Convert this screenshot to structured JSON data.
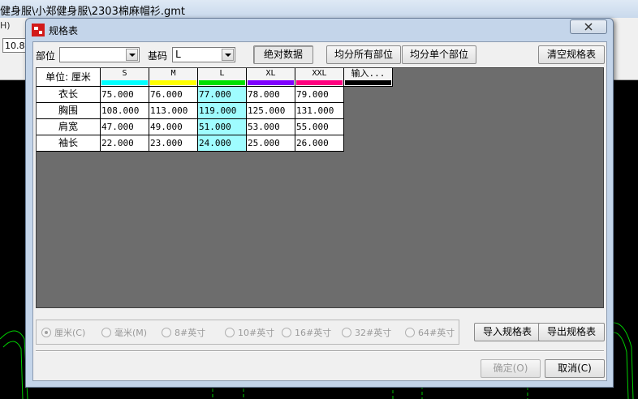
{
  "background_app": {
    "title": "健身服\\小郑健身服\\2303棉麻帽衫.gmt",
    "menu_fragment": "H)",
    "toolbar_value": "10.8"
  },
  "dialog": {
    "title": "规格表",
    "part_label": "部位",
    "part_value": "",
    "base_size_label": "基码",
    "base_size_value": "L",
    "absolute_data_label": "绝对数据",
    "distribute_all_label": "均分所有部位",
    "distribute_single_label": "均分单个部位",
    "clear_table_label": "清空规格表",
    "grid": {
      "unit_header": "单位: 厘米",
      "input_header": "输入...",
      "base_size": "L",
      "sizes": [
        {
          "name": "S",
          "color": "#00ffff"
        },
        {
          "name": "M",
          "color": "#ffff00"
        },
        {
          "name": "L",
          "color": "#00e000"
        },
        {
          "name": "XL",
          "color": "#8000ff"
        },
        {
          "name": "XXL",
          "color": "#ff0080"
        }
      ],
      "input_color": "#000000",
      "rows": [
        {
          "part": "衣长",
          "values": [
            "75.000",
            "76.000",
            "77.000",
            "78.000",
            "79.000"
          ]
        },
        {
          "part": "胸围",
          "values": [
            "108.000",
            "113.000",
            "119.000",
            "125.000",
            "131.000"
          ]
        },
        {
          "part": "肩宽",
          "values": [
            "47.000",
            "49.000",
            "51.000",
            "53.000",
            "55.000"
          ]
        },
        {
          "part": "袖长",
          "values": [
            "22.000",
            "23.000",
            "24.000",
            "25.000",
            "26.000"
          ]
        }
      ]
    },
    "units": [
      {
        "label": "厘米(C)",
        "checked": true
      },
      {
        "label": "毫米(M)",
        "checked": false
      },
      {
        "label": "8#英寸",
        "checked": false
      },
      {
        "label": "10#英寸",
        "checked": false
      },
      {
        "label": "16#英寸",
        "checked": false
      },
      {
        "label": "32#英寸",
        "checked": false
      },
      {
        "label": "64#英寸",
        "checked": false
      }
    ],
    "import_label": "导入规格表",
    "export_label": "导出规格表",
    "ok_label": "确定(O)",
    "cancel_label": "取消(C)"
  },
  "colors": {
    "grid_background": "#6d6d6d",
    "base_column": "#9ffcff",
    "dialog_frame": "#c4d5ea"
  }
}
